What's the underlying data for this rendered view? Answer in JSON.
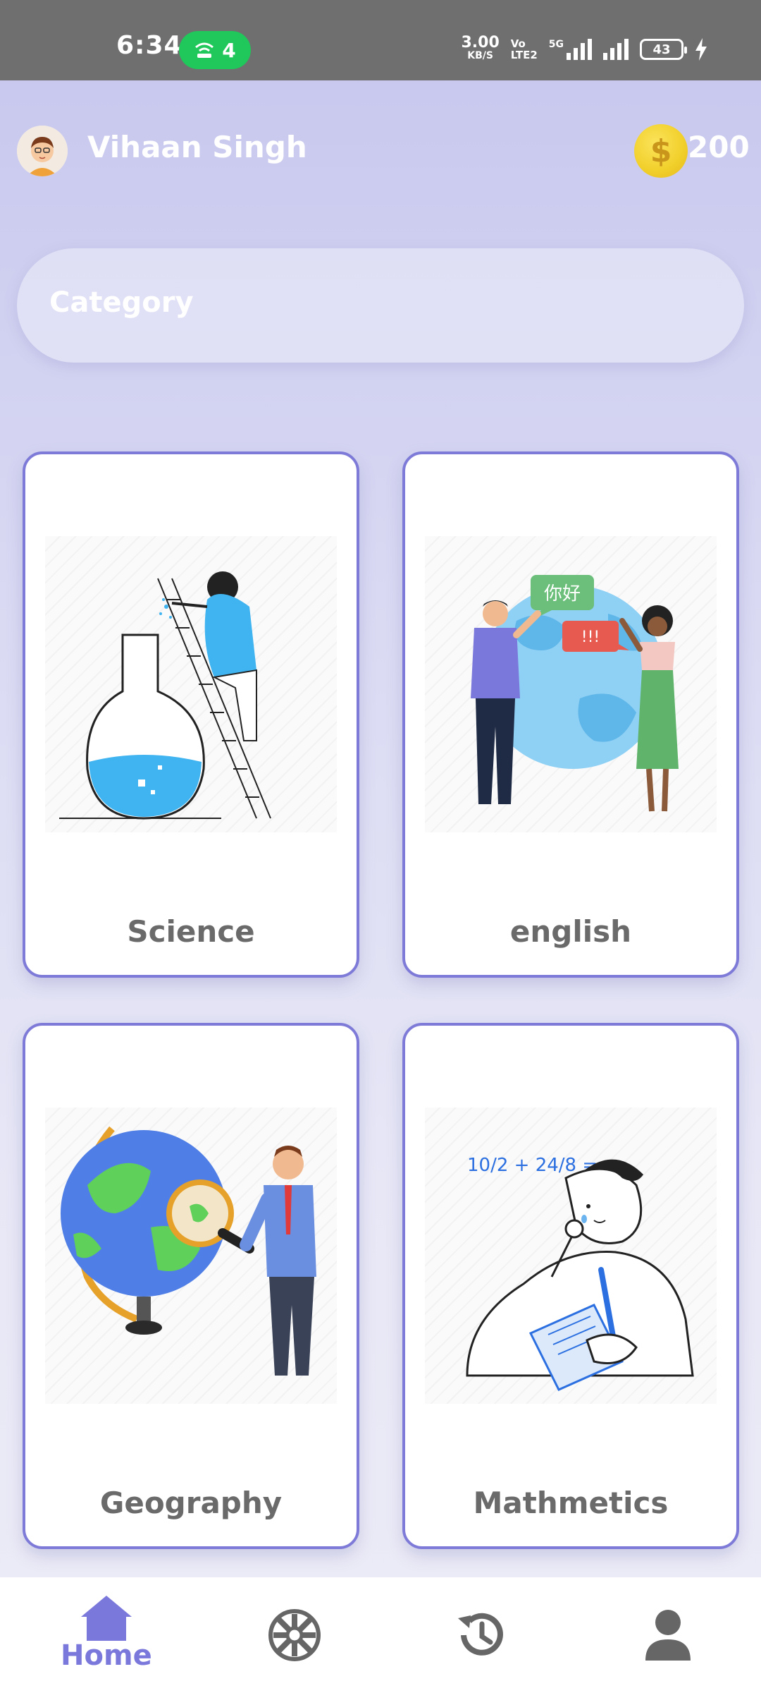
{
  "status_bar": {
    "time": "6:34",
    "hotspot_count": "4",
    "net_speed_value": "3.00",
    "net_speed_unit": "KB/S",
    "volte_top": "Vo",
    "volte_bottom": "LTE2",
    "network_type": "5G",
    "battery": "43"
  },
  "header": {
    "user_name": "Vihaan Singh",
    "coin_symbol": "$",
    "coins": "200"
  },
  "category_bar": {
    "label": "Category"
  },
  "categories": [
    {
      "title": "Science",
      "icon": "science-flask-illustration"
    },
    {
      "title": "english",
      "icon": "language-globe-illustration"
    },
    {
      "title": "Geography",
      "icon": "globe-magnifier-illustration"
    },
    {
      "title": "Mathmetics",
      "icon": "math-thinker-illustration"
    }
  ],
  "english_bubbles": [
    "你好",
    "!!!"
  ],
  "math_formula": "10/2 + 24/8 = x",
  "bottom_nav": {
    "home_label": "Home",
    "items": [
      "home-icon",
      "spin-wheel-icon",
      "history-icon",
      "profile-icon"
    ]
  },
  "colors": {
    "accent": "#7b78dc",
    "card_border": "#7e7ad8",
    "status_bar": "#6f6f6f",
    "hotspot": "#20c75a",
    "coin": "#f1cf2a"
  }
}
